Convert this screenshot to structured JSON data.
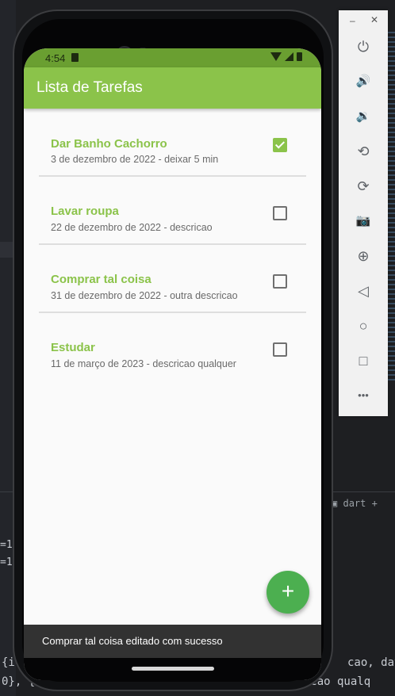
{
  "app": {
    "title": "Lista de Tarefas",
    "accent_color": "#8bc34a",
    "fab_color": "#4caf50"
  },
  "status_bar": {
    "time": "4:54",
    "icons": [
      "sd-card-icon",
      "wifi-icon",
      "signal-icon",
      "battery-icon"
    ]
  },
  "tasks": [
    {
      "title": "Dar Banho Cachorro",
      "subtitle": "3 de dezembro de 2022 - deixar 5 min",
      "done": true
    },
    {
      "title": "Lavar roupa",
      "subtitle": "22 de dezembro de 2022 - descricao",
      "done": false
    },
    {
      "title": "Comprar tal coisa",
      "subtitle": "31 de dezembro de 2022 - outra descricao",
      "done": false
    },
    {
      "title": "Estudar",
      "subtitle": "11 de março de 2023 - descricao qualquer",
      "done": false
    }
  ],
  "fab": {
    "label": "+",
    "icon": "add-icon"
  },
  "snackbar": {
    "message": "Comprar tal coisa editado com sucesso"
  },
  "emulator_toolbar": {
    "window_minimize": "–",
    "window_close": "✕",
    "buttons": [
      {
        "name": "power-icon",
        "glyph": "⏻"
      },
      {
        "name": "volume-up-icon",
        "glyph": "🔊"
      },
      {
        "name": "volume-down-icon",
        "glyph": "🔉"
      },
      {
        "name": "rotate-left-icon",
        "glyph": "⟲"
      },
      {
        "name": "rotate-right-icon",
        "glyph": "⟳"
      },
      {
        "name": "camera-icon",
        "glyph": "📷"
      },
      {
        "name": "zoom-icon",
        "glyph": "⊕"
      },
      {
        "name": "back-icon",
        "glyph": "◁"
      },
      {
        "name": "home-icon",
        "glyph": "○"
      },
      {
        "name": "overview-icon",
        "glyph": "□"
      },
      {
        "name": "more-icon",
        "glyph": "•••"
      }
    ]
  },
  "ide_background": {
    "terminal_label": "dart",
    "terminal_plus": "+",
    "code_line_1_left": "{i",
    "code_line_1_right": "cao, data",
    "code_line_2_left": "0}, {",
    "code_line_2_right": "cricao qualq",
    "gutter_1": "=1",
    "gutter_2": "=1"
  }
}
